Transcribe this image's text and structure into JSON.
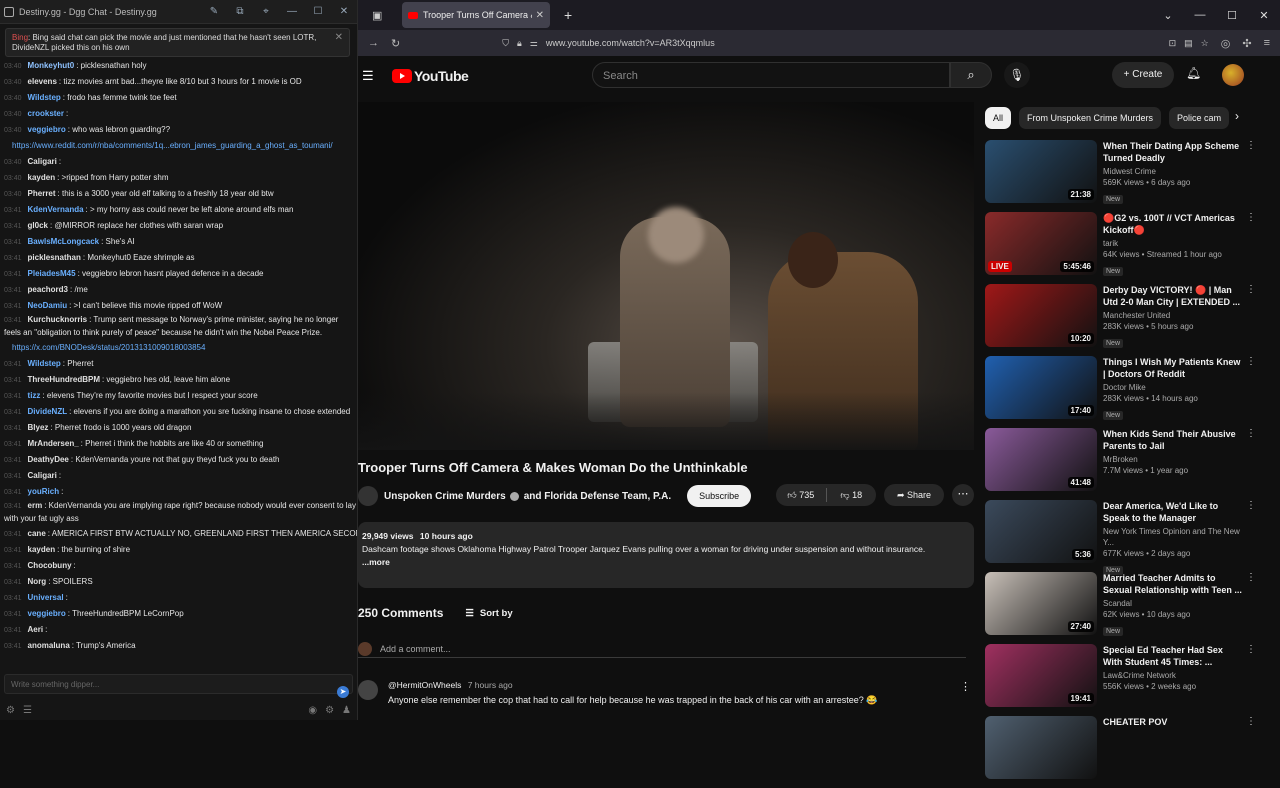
{
  "chat": {
    "window_title": "Destiny.gg - Dgg Chat - Destiny.gg",
    "pinned": {
      "user": "Bing",
      "text": ": Bing said chat can pick the movie and just mentioned that he hasn't seen LOTR, DivideNZL picked this on his own"
    },
    "lines": [
      {
        "time": "03:40",
        "user": "Monkeyhut0",
        "color": "#8fc2ff",
        "text": ": picklesnathan holy"
      },
      {
        "time": "03:40",
        "user": "elevens",
        "color": "#e0e0e0",
        "text": ": tizz movies arnt bad...theyre like 8/10 but 3 hours for 1 movie is OD"
      },
      {
        "time": "03:40",
        "user": "Wildstep",
        "color": "#6ab0ff",
        "text": ": frodo has femme twink toe feet"
      },
      {
        "time": "03:40",
        "user": "crookster",
        "color": "#6ab0ff",
        "text": ":"
      },
      {
        "time": "03:40",
        "user": "veggiebro",
        "color": "#6ab0ff",
        "text": ": who was lebron guarding??"
      },
      {
        "time": "",
        "user": "",
        "color": "#6ab0ff",
        "text": "https://www.reddit.com/r/nba/comments/1q...ebron_james_guarding_a_ghost_as_toumani/"
      },
      {
        "time": "03:40",
        "user": "Caligari",
        "color": "#e0e0e0",
        "text": ":"
      },
      {
        "time": "03:40",
        "user": "kayden",
        "color": "#e0e0e0",
        "text": ": >ripped from Harry potter shm"
      },
      {
        "time": "03:40",
        "user": "Pherret",
        "color": "#e0e0e0",
        "text": ": this is a 3000 year old elf talking to a freshly 18 year old btw"
      },
      {
        "time": "03:41",
        "user": "KdenVernanda",
        "color": "#6ab0ff",
        "text": ": > my horny ass could never be left alone around elfs man"
      },
      {
        "time": "03:41",
        "user": "gl0ck",
        "color": "#e0e0e0",
        "text": ": @MIRROR replace her clothes with saran wrap"
      },
      {
        "time": "03:41",
        "user": "BawlsMcLongcack",
        "color": "#6ab0ff",
        "text": ": She's AI"
      },
      {
        "time": "03:41",
        "user": "picklesnathan",
        "color": "#e0e0e0",
        "text": ": Monkeyhut0 Eaze shrimple as"
      },
      {
        "time": "03:41",
        "user": "PleiadesM45",
        "color": "#6ab0ff",
        "text": ": veggiebro lebron hasnt played defence in a decade"
      },
      {
        "time": "03:41",
        "user": "peachord3",
        "color": "#e0e0e0",
        "text": ": /me"
      },
      {
        "time": "03:41",
        "user": "NeoDamiu",
        "color": "#6ab0ff",
        "text": ": >I can't believe this movie ripped off WoW"
      },
      {
        "time": "03:41",
        "user": "Kurchucknorris",
        "color": "#e0e0e0",
        "text": ": Trump sent message to Norway's prime minister, saying he no longer feels an \"obligation to think purely of peace\" because he didn't win the Nobel Peace Prize."
      },
      {
        "time": "",
        "user": "",
        "color": "#6ab0ff",
        "text": "https://x.com/BNODesk/status/2013131009018003854"
      },
      {
        "time": "03:41",
        "user": "Wildstep",
        "color": "#6ab0ff",
        "text": ": Pherret"
      },
      {
        "time": "03:41",
        "user": "ThreeHundredBPM",
        "color": "#e0e0e0",
        "text": ": veggiebro hes old, leave him alone"
      },
      {
        "time": "03:41",
        "user": "tizz",
        "color": "#6ab0ff",
        "text": ": elevens They're my favorite movies but I respect your score"
      },
      {
        "time": "03:41",
        "user": "DivideNZL",
        "color": "#6ab0ff",
        "text": ": elevens if you are doing a marathon you sre fucking insane to chose extended"
      },
      {
        "time": "03:41",
        "user": "Blyez",
        "color": "#e0e0e0",
        "text": ": Pherret frodo is 1000 years old dragon"
      },
      {
        "time": "03:41",
        "user": "MrAndersen_",
        "color": "#e0e0e0",
        "text": ": Pherret i think the hobbits are like 40 or something"
      },
      {
        "time": "03:41",
        "user": "DeathyDee",
        "color": "#e0e0e0",
        "text": ": KdenVernanda youre not that guy theyd fuck you to death"
      },
      {
        "time": "03:41",
        "user": "Caligari",
        "color": "#e0e0e0",
        "text": ":"
      },
      {
        "time": "03:41",
        "user": "youRich",
        "color": "#6ab0ff",
        "text": ":"
      },
      {
        "time": "03:41",
        "user": "erm",
        "color": "#e0e0e0",
        "text": ": KdenVernanda you are implying rape right? because nobody would ever consent to lay with your fat ugly ass"
      },
      {
        "time": "03:41",
        "user": "cane",
        "color": "#e0e0e0",
        "text": ": AMERICA FIRST BTW ACTUALLY NO, GREENLAND FIRST THEN AMERICA SECOND"
      },
      {
        "time": "03:41",
        "user": "kayden",
        "color": "#e0e0e0",
        "text": ": the burning of shire"
      },
      {
        "time": "03:41",
        "user": "Chocobuny",
        "color": "#e0e0e0",
        "text": ":"
      },
      {
        "time": "03:41",
        "user": "Norg",
        "color": "#e0e0e0",
        "text": ": SPOILERS"
      },
      {
        "time": "03:41",
        "user": "Universal",
        "color": "#6ab0ff",
        "text": ":"
      },
      {
        "time": "03:41",
        "user": "veggiebro",
        "color": "#6ab0ff",
        "text": ": ThreeHundredBPM LeCornPop"
      },
      {
        "time": "03:41",
        "user": "Aeri",
        "color": "#e0e0e0",
        "text": ":"
      },
      {
        "time": "03:41",
        "user": "anomaluna",
        "color": "#e0e0e0",
        "text": ": Trump's America"
      }
    ],
    "input_placeholder": "Write something dipper..."
  },
  "browser": {
    "tab_title": "Trooper Turns Off Camera & M",
    "url": "www.youtube.com/watch?v=AR3tXqqmlus"
  },
  "youtube": {
    "logo": "YouTube",
    "search_placeholder": "Search",
    "create_label": "Create",
    "video": {
      "title": "Trooper Turns Off Camera & Makes Woman Do the Unthinkable",
      "channel": "Unspoken Crime Murders",
      "collab": "and Florida Defense Team, P.A.",
      "subscribe": "Subscribe",
      "likes": "735",
      "dislikes": "18",
      "share": "Share",
      "views": "29,949 views",
      "age": "10 hours ago",
      "description": "Dashcam footage shows Oklahoma Highway Patrol Trooper Jarquez Evans pulling over a woman for driving under suspension and without insurance.",
      "more": "...more"
    },
    "comments": {
      "count": "250 Comments",
      "sort": "Sort by",
      "add_placeholder": "Add a comment...",
      "first": {
        "author": "@HermitOnWheels",
        "time": "7 hours ago",
        "text": "Anyone else remember the cop that had to call for help because he was trapped in the back of his car with an arrestee? 😂"
      }
    },
    "chips": [
      "All",
      "From Unspoken Crime Murders",
      "Police cam"
    ],
    "recommendations": [
      {
        "title": "When Their Dating App Scheme Turned Deadly",
        "channel": "Midwest Crime",
        "meta": "569K views • 6 days ago",
        "badge": "New",
        "duration": "21:38",
        "live": "",
        "thumb": "#2a4f70"
      },
      {
        "title": "🔴G2 vs. 100T // VCT Americas Kickoff🔴",
        "channel": "tarik",
        "meta": "64K views • Streamed 1 hour ago",
        "badge": "New",
        "duration": "5:45:46",
        "live": "LIVE",
        "thumb": "#8a2a2a"
      },
      {
        "title": "Derby Day VICTORY! 🔴 | Man Utd 2-0 Man City | EXTENDED ...",
        "channel": "Manchester United",
        "meta": "283K views • 5 hours ago",
        "badge": "New",
        "duration": "10:20",
        "live": "",
        "thumb": "#a01818"
      },
      {
        "title": "Things I Wish My Patients Knew | Doctors Of Reddit",
        "channel": "Doctor Mike",
        "meta": "283K views • 14 hours ago",
        "badge": "New",
        "duration": "17:40",
        "live": "",
        "thumb": "#2060b0"
      },
      {
        "title": "When Kids Send Their Abusive Parents to Jail",
        "channel": "MrBroken",
        "meta": "7.7M views • 1 year ago",
        "badge": "",
        "duration": "41:48",
        "live": "",
        "thumb": "#8a5a9a"
      },
      {
        "title": "Dear America, We'd Like to Speak to the Manager",
        "channel": "New York Times Opinion and The New Y...",
        "meta": "677K views • 2 days ago",
        "badge": "New",
        "duration": "5:36",
        "live": "",
        "thumb": "#3b4a5c"
      },
      {
        "title": "Married Teacher Admits to Sexual Relationship with Teen ...",
        "channel": "Scandal",
        "meta": "62K views • 10 days ago",
        "badge": "New",
        "duration": "27:40",
        "live": "",
        "thumb": "#c8c0b8"
      },
      {
        "title": "Special Ed Teacher Had Sex With Student 45 Times: ...",
        "channel": "Law&Crime Network",
        "meta": "556K views • 2 weeks ago",
        "badge": "",
        "duration": "19:41",
        "live": "",
        "thumb": "#a03060"
      },
      {
        "title": "CHEATER POV",
        "channel": "",
        "meta": "",
        "badge": "",
        "duration": "",
        "live": "",
        "thumb": "#506070"
      }
    ]
  }
}
